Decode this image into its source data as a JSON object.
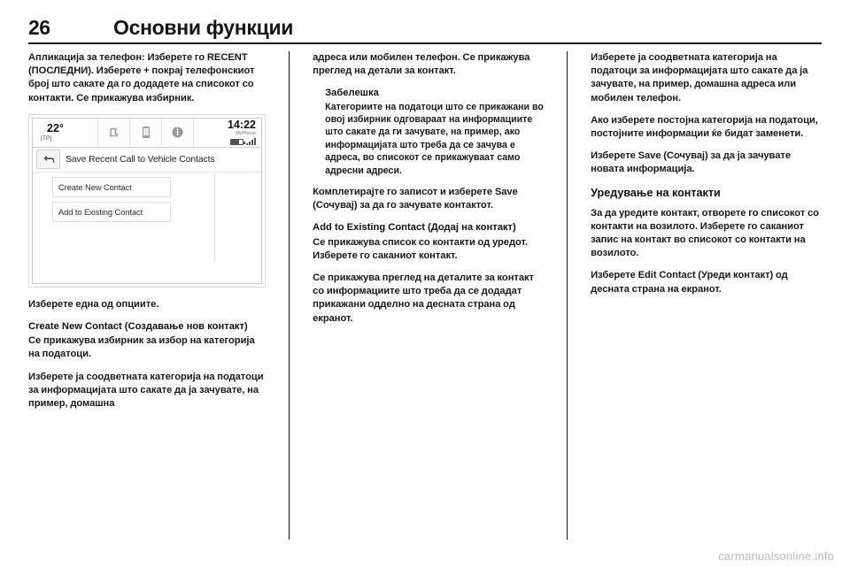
{
  "header": {
    "page_number": "26",
    "chapter_title": "Основни функции"
  },
  "column1": {
    "para1": "Апликација за телефон: Изберете го RECENT (ПОСЛЕДНИ). Изберете + покрај телефонскиот број што сакате да го додадете на списокот со контакти. Се прикажува избирник.",
    "para2": "Изберете една од опциите.",
    "subhead1": "Create New Contact (Создавање нов контакт)",
    "para3": "Се прикажува избирник за избор на категорија на податоци.",
    "para4": "Изберете ја соодветната категорија на податоци за информацијата што сакате да ја зачувате, на пример, домашна"
  },
  "column2": {
    "para1": "адреса или мобилен телефон. Се прикажува преглед на детали за контакт.",
    "note_title": "Забелешка",
    "note_body": "Категориите на податоци што се прикажани во овој избирник одговараат на информациите што сакате да ги зачувате, на пример, ако информацијата што треба да се зачува е адреса, во списокот се прикажуваат само адресни адреси.",
    "para2": "Комплетирајте го записот и изберете Save (Сочувај) за да го зачувате контактот.",
    "subhead1": "Add to Existing Contact (Додај на контакт)",
    "para3": "Се прикажува список со контакти од уредот. Изберете го саканиот контакт.",
    "para4": "Се прикажува преглед на деталите за контакт со информациите што треба да се додадат прикажани одделно на десната страна од екранот."
  },
  "column3": {
    "para1": "Изберете ја соодветната категорија на податоци за информацијата што сакате да ја зачувате, на пример, домашна адреса или мобилен телефон.",
    "para2": "Ако изберете постојна категорија на податоци, постојните информации ќе бидат заменети.",
    "para3": "Изберете Save (Сочувај) за да ја зачувате новата информација.",
    "heading1": "Уредување на контакти",
    "para4": "За да уредите контакт, отворете го списокот со контакти на возилото. Изберете го саканиот запис на контакт во списокот со контакти на возилото.",
    "para5": "Изберете Edit Contact (Уреди контакт) од десната страна на екранот."
  },
  "infotainment": {
    "temperature": "22°",
    "tp_label": "[TP]",
    "clock": "14:22",
    "phone_name": "MyPhone",
    "status_icons": [
      "seat-heater-icon",
      "phone-icon",
      "info-icon"
    ],
    "back_icon": "back-arrow-icon",
    "screen_title": "Save Recent Call to Vehicle Contacts",
    "menu_items": [
      "Create New Contact",
      "Add to Existing Contact"
    ]
  },
  "watermark": "carmanualsonline.info"
}
